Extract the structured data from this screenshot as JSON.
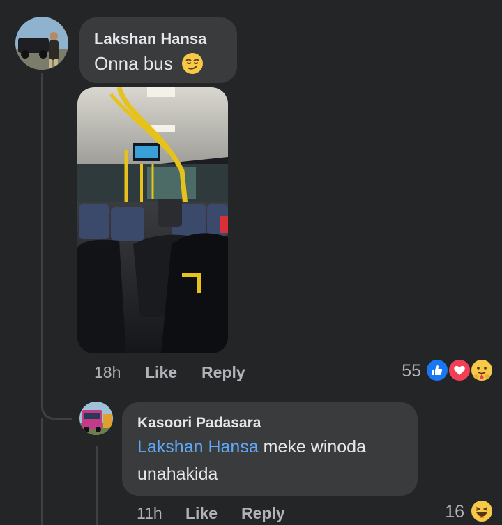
{
  "comment": {
    "author": "Lakshan Hansa",
    "text": "Onna bus",
    "emoji": "smirk-emoji",
    "time": "18h",
    "like_label": "Like",
    "reply_label": "Reply",
    "reaction_count": "55",
    "reactions": [
      "like",
      "love",
      "care"
    ]
  },
  "reply": {
    "author": "Kasoori Padasara",
    "mention": "Lakshan Hansa",
    "text_line1": " meke winoda",
    "text_line2": "unahakida",
    "time": "11h",
    "like_label": "Like",
    "reply_label": "Reply",
    "reaction_count": "16",
    "reactions": [
      "haha"
    ]
  },
  "colors": {
    "background": "#242526",
    "bubble": "#3a3b3c",
    "mention": "#5fa8f5",
    "like_blue": "#1877f2",
    "love_red": "#f33e58",
    "emoji_yellow": "#f7c948"
  }
}
